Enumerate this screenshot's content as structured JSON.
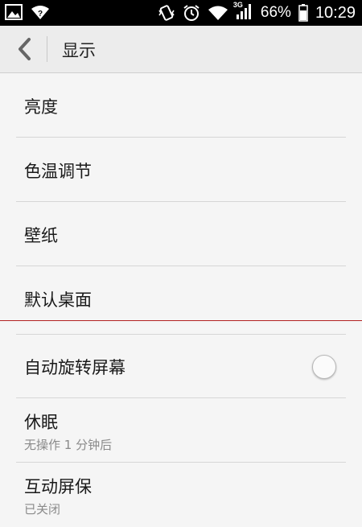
{
  "status_bar": {
    "network_type": "3G",
    "battery_percent": "66%",
    "time": "10:29",
    "icons": [
      "image-icon",
      "wifi-question-icon",
      "vibrate-icon",
      "alarm-icon",
      "wifi-icon",
      "signal-icon",
      "battery-icon"
    ]
  },
  "header": {
    "back_icon": "chevron-left-icon",
    "title": "显示"
  },
  "settings": {
    "brightness": {
      "label": "亮度"
    },
    "color_temp": {
      "label": "色温调节"
    },
    "wallpaper": {
      "label": "壁纸"
    },
    "default_desktop": {
      "label": "默认桌面"
    },
    "auto_rotate": {
      "label": "自动旋转屏幕",
      "enabled": false
    },
    "sleep": {
      "label": "休眠",
      "value": "无操作 1 分钟后"
    },
    "screensaver": {
      "label": "互动屏保",
      "value": "已关闭"
    }
  },
  "colors": {
    "status_bar_bg": "#000000",
    "header_bg": "#ececec",
    "list_bg": "#f5f5f5",
    "divider_accent": "#b22222"
  }
}
